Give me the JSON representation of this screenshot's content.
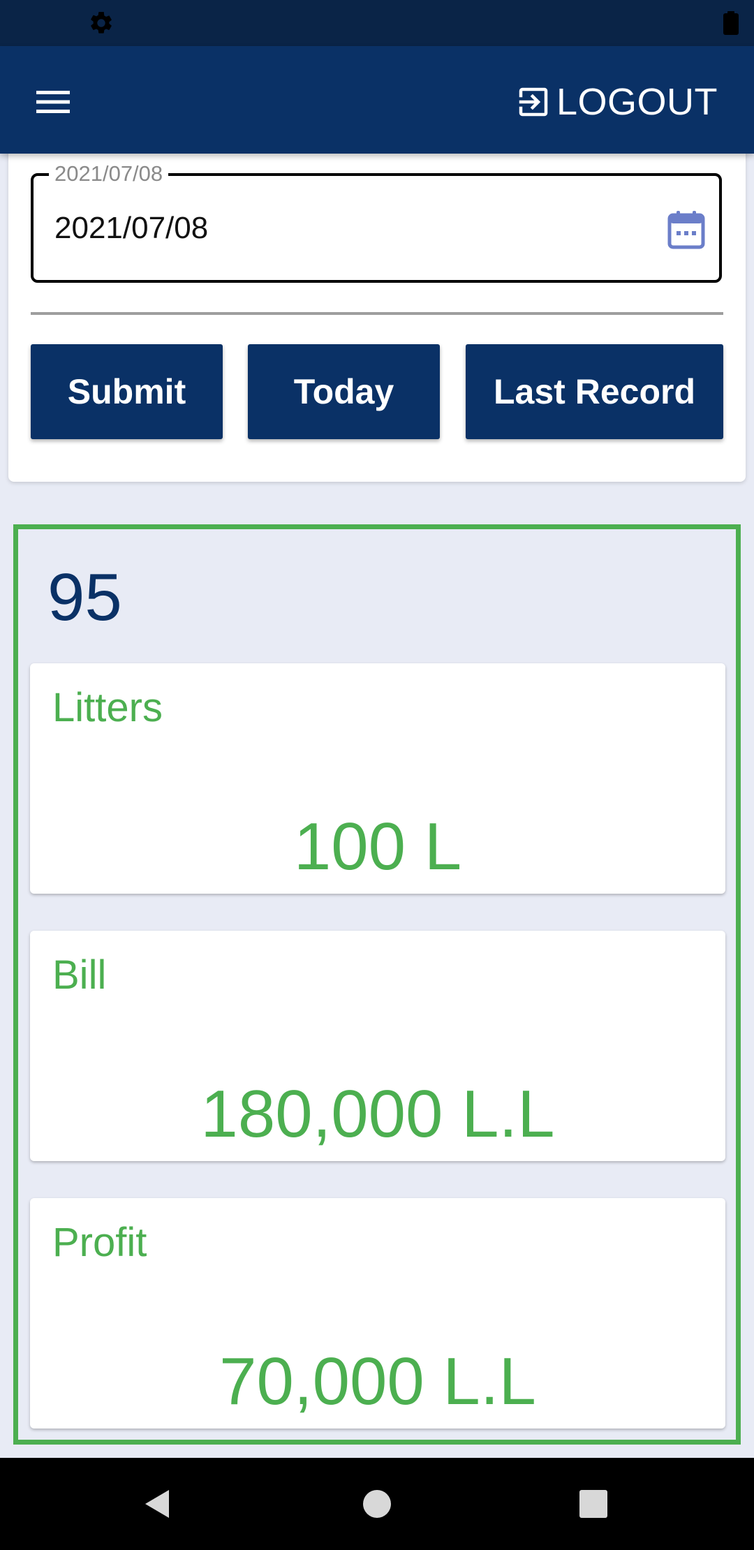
{
  "status_bar": {
    "icons": [
      "gear-icon",
      "battery-icon"
    ]
  },
  "app_bar": {
    "menu_icon": "hamburger-menu-icon",
    "logout_icon": "logout-icon",
    "logout_label": "LOGOUT"
  },
  "form": {
    "date_field": {
      "label": "2021/07/08",
      "value": "2021/07/08",
      "icon": "calendar-icon"
    },
    "buttons": {
      "submit": "Submit",
      "today": "Today",
      "last_record": "Last Record"
    }
  },
  "summary": {
    "count": "95",
    "cards": [
      {
        "label": "Litters",
        "value": "100 L"
      },
      {
        "label": "Bill",
        "value": "180,000 L.L"
      },
      {
        "label": "Profit",
        "value": "70,000 L.L"
      }
    ]
  },
  "nav_bar": {
    "icons": [
      "back-icon",
      "home-icon",
      "recents-icon"
    ]
  },
  "colors": {
    "primary": "#0a3166",
    "accent_green": "#4caf50",
    "page_background": "#e8ebf5"
  }
}
